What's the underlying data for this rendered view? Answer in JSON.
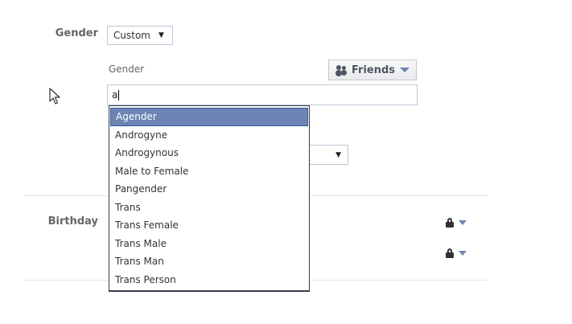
{
  "gender_section": {
    "label": "Gender",
    "select_value": "Custom",
    "sub_label": "Gender",
    "audience_button": "Friends",
    "input_value": "a"
  },
  "birthday_section": {
    "label": "Birthday"
  },
  "autocomplete": {
    "items": [
      "Agender",
      "Androgyne",
      "Androgynous",
      "Male to Female",
      "Pangender",
      "Trans",
      "Trans Female",
      "Trans Male",
      "Trans Man",
      "Trans Person"
    ],
    "selected_index": 0
  },
  "icons": {
    "friends": "friends-icon",
    "lock": "lock-icon",
    "cursor": "mouse-pointer-icon"
  },
  "colors": {
    "highlight": "#6d84b4",
    "highlight_border": "#3b5998",
    "label": "#666666"
  }
}
